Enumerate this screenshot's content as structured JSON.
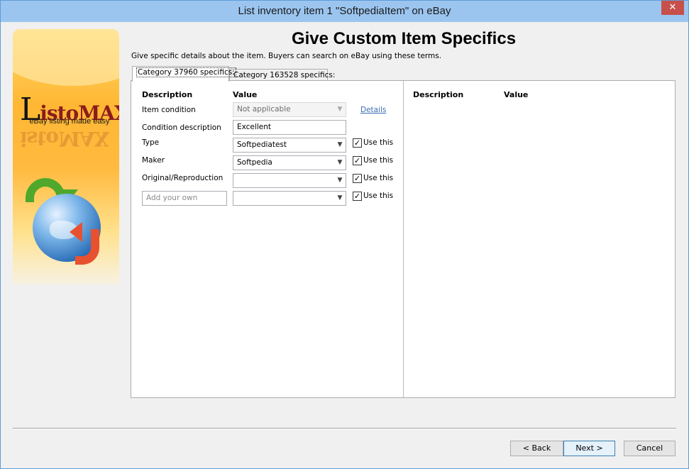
{
  "window": {
    "title": "List inventory item 1 \"SoftpediaItem\" on eBay",
    "close_glyph": "✕"
  },
  "banner": {
    "logo_first": "L",
    "logo_rest": "istoMAX",
    "tagline": "eBay listing made easy"
  },
  "header": {
    "title": "Give Custom Item Specifics",
    "subtitle": "Give specific details about the item.  Buyers can search on eBay using these terms."
  },
  "tabs": [
    {
      "label": "Category 37960 specifics:",
      "active": true
    },
    {
      "label": "Category 163528 specifics:",
      "active": false
    }
  ],
  "left_pane": {
    "col_description": "Description",
    "col_value": "Value",
    "rows": [
      {
        "label": "Item condition",
        "value": "Not applicable",
        "disabled": true,
        "link": "Details"
      },
      {
        "label": "Condition description",
        "value": "Excellent"
      },
      {
        "label": "Type",
        "value": "Softpediatest",
        "use_this": "Use this",
        "checked": true
      },
      {
        "label": "Maker",
        "value": "Softpedia",
        "use_this": "Use this",
        "checked": true
      },
      {
        "label": "Original/Reproduction",
        "value": "",
        "use_this": "Use this",
        "checked": true
      },
      {
        "placeholder": "Add your own",
        "value": "",
        "use_this": "Use this",
        "checked": true
      }
    ]
  },
  "right_pane": {
    "col_description": "Description",
    "col_value": "Value"
  },
  "footer": {
    "back": "< Back",
    "next": "Next >",
    "cancel": "Cancel"
  },
  "icons": {
    "chevron": "chevron-down-icon",
    "check": "checkmark-icon",
    "globe": "globe-icon"
  },
  "colors": {
    "titlebar": "#9bc5ef",
    "close": "#c7504b",
    "link": "#3d6db5",
    "banner": "#ffb733"
  }
}
